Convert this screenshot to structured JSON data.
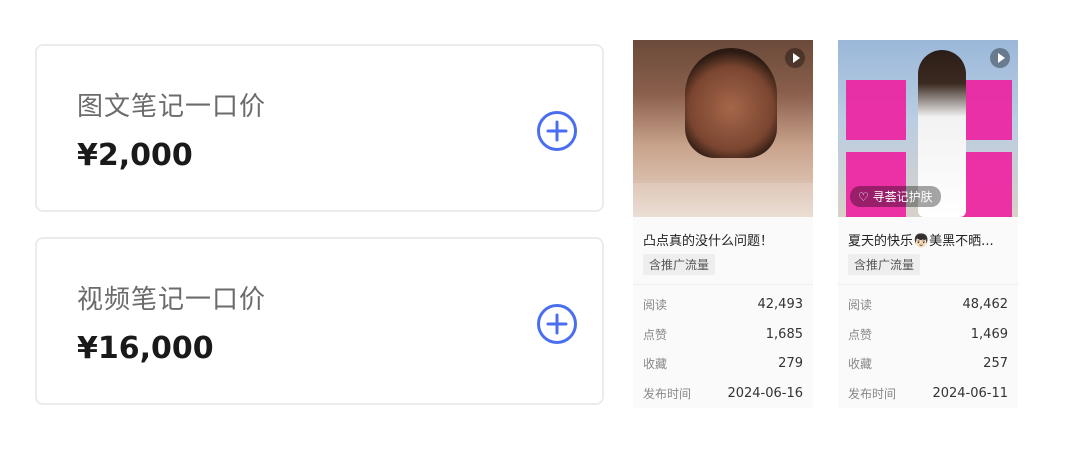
{
  "price_cards": [
    {
      "title": "图文笔记一口价",
      "price": "¥2,000"
    },
    {
      "title": "视频笔记一口价",
      "price": "¥16,000"
    }
  ],
  "icons": {
    "add": "plus-circle-icon",
    "play": "play-icon"
  },
  "colors": {
    "accent": "#4a6ef0",
    "card_border": "#ebebeb",
    "thumb_pink": "#ee1fa0"
  },
  "notes": [
    {
      "title": "凸点真的没什么问题！",
      "tag": "含推广流量",
      "stats": [
        {
          "label": "阅读",
          "value": "42,493"
        },
        {
          "label": "点赞",
          "value": "1,685"
        },
        {
          "label": "收藏",
          "value": "279"
        },
        {
          "label": "发布时间",
          "value": "2024-06-16"
        }
      ]
    },
    {
      "title": "夏天的快乐👦🏻美黑不晒...",
      "badge": "♡ 寻荟记护肤",
      "tag": "含推广流量",
      "stats": [
        {
          "label": "阅读",
          "value": "48,462"
        },
        {
          "label": "点赞",
          "value": "1,469"
        },
        {
          "label": "收藏",
          "value": "257"
        },
        {
          "label": "发布时间",
          "value": "2024-06-11"
        }
      ]
    }
  ]
}
